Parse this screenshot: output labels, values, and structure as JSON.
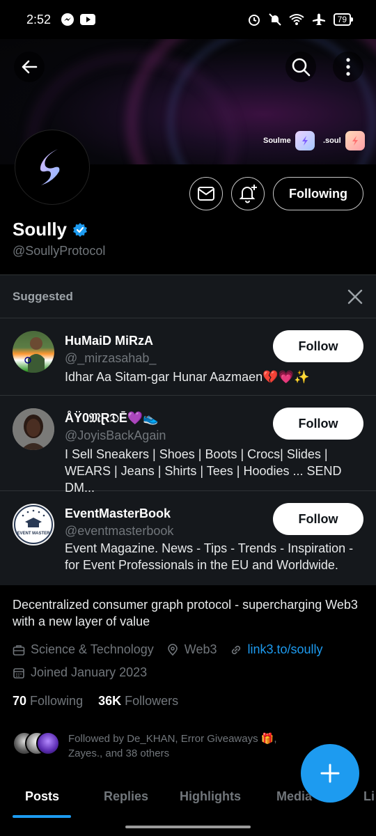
{
  "status_bar": {
    "time": "2:52",
    "battery": "79"
  },
  "banner": {
    "brand_left": "Soulme",
    "brand_right": ".soul"
  },
  "profile": {
    "name": "Soully",
    "handle": "@SoullyProtocol",
    "following_button": "Following",
    "bio": "Decentralized consumer graph protocol - supercharging Web3 with a new layer of value",
    "category": "Science & Technology",
    "location": "Web3",
    "link": "link3.to/soully",
    "joined": "Joined January 2023",
    "following_count": "70",
    "following_label": "Following",
    "followers_count": "36K",
    "followers_label": "Followers",
    "followed_by": "Followed by De_KHAN, Error Giveaways 🎁, Zayes., and 38 others"
  },
  "suggested": {
    "title": "Suggested",
    "follow_label": "Follow",
    "items": [
      {
        "name": "HuMaiD MiRzA",
        "handle": "@_mirzasahab_",
        "bio": "Idhar Aa Sitam-gar Hunar Aazmaen💔💗✨"
      },
      {
        "name": "ÅŸ0𝔐Ɽ𝔇Ē💜👟",
        "handle": "@JoyisBackAgain",
        "bio": "I Sell Sneakers | Shoes | Boots | Crocs| Slides | WEARS | Jeans | Shirts | Tees | Hoodies ... SEND DM..."
      },
      {
        "name": "EventMasterBook",
        "handle": "@eventmasterbook",
        "bio": "Event Magazine. News - Tips - Trends - Inspiration - for Event Professionals in the EU and Worldwide."
      }
    ]
  },
  "tabs": [
    "Posts",
    "Replies",
    "Highlights",
    "Media",
    "Li"
  ],
  "colors": {
    "accent": "#1d9bf0",
    "background": "#000000",
    "panel": "#15181c",
    "muted_text": "#71767b"
  }
}
